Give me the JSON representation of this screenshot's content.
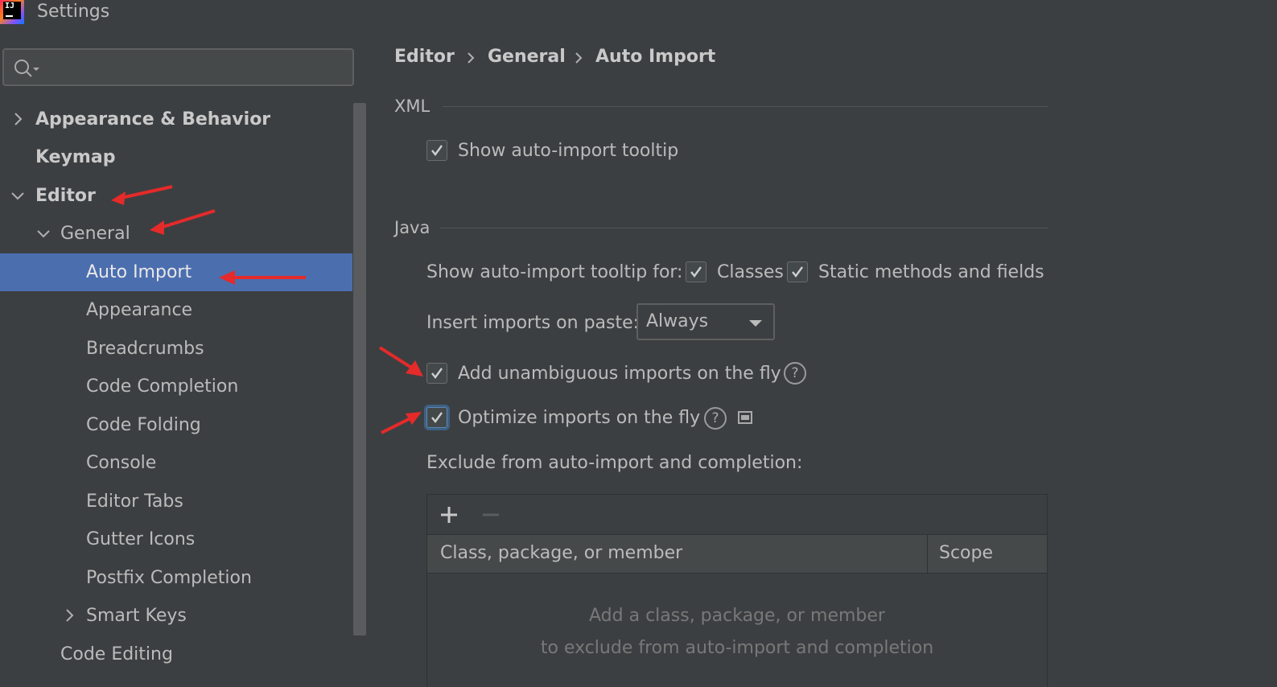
{
  "window": {
    "title": "Settings",
    "logo_text": "IJ"
  },
  "sidebar": {
    "search": {
      "placeholder": "",
      "value": ""
    },
    "items": [
      {
        "label": "Appearance & Behavior",
        "expanded": false,
        "bold": true
      },
      {
        "label": "Keymap",
        "bold": true
      },
      {
        "label": "Editor",
        "expanded": true,
        "bold": true
      },
      {
        "label": "General",
        "expanded": true
      },
      {
        "label": "Auto Import",
        "selected": true
      },
      {
        "label": "Appearance"
      },
      {
        "label": "Breadcrumbs"
      },
      {
        "label": "Code Completion"
      },
      {
        "label": "Code Folding"
      },
      {
        "label": "Console"
      },
      {
        "label": "Editor Tabs"
      },
      {
        "label": "Gutter Icons"
      },
      {
        "label": "Postfix Completion"
      },
      {
        "label": "Smart Keys",
        "expanded": false
      },
      {
        "label": "Code Editing"
      }
    ]
  },
  "breadcrumb": [
    "Editor",
    "General",
    "Auto Import"
  ],
  "xml_section": {
    "title": "XML",
    "show_tooltip": {
      "label": "Show auto-import tooltip",
      "checked": true
    }
  },
  "java_section": {
    "title": "Java",
    "tooltip_for_label": "Show auto-import tooltip for:",
    "classes": {
      "label": "Classes",
      "checked": true
    },
    "static_members": {
      "label": "Static methods and fields",
      "checked": true
    },
    "insert_on_paste": {
      "label": "Insert imports on paste:",
      "value": "Always"
    },
    "add_unambiguous": {
      "label": "Add unambiguous imports on the fly",
      "checked": true
    },
    "optimize_imports": {
      "label": "Optimize imports on the fly",
      "checked": true
    },
    "exclude_label": "Exclude from auto-import and completion:",
    "exclude_table": {
      "columns": [
        "Class, package, or member",
        "Scope"
      ],
      "empty_text": [
        "Add a class, package, or member",
        "to exclude from auto-import and completion"
      ]
    }
  },
  "colors": {
    "background": "#3c3f41",
    "selection": "#4b6eaf",
    "annotation_arrow": "#e52a2a"
  }
}
